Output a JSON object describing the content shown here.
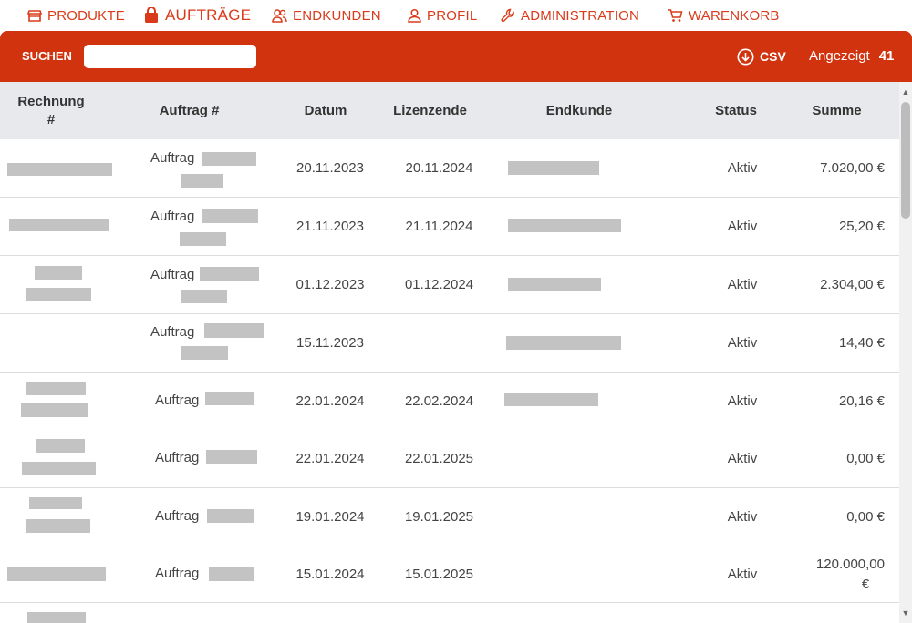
{
  "nav": [
    {
      "label": "PRODUKTE",
      "icon": "shop-icon"
    },
    {
      "label": "AUFTRÄGE",
      "icon": "bag-icon"
    },
    {
      "label": "ENDKUNDEN",
      "icon": "users-icon"
    },
    {
      "label": "PROFIL",
      "icon": "user-icon"
    },
    {
      "label": "ADMINISTRATION",
      "icon": "wrench-icon"
    },
    {
      "label": "WARENKORB",
      "icon": "cart-icon"
    }
  ],
  "toolbar": {
    "search_label": "SUCHEN",
    "search_value": "",
    "csv_label": "CSV",
    "shown_label": "Angezeigt",
    "shown_count": "41"
  },
  "table": {
    "headers": {
      "rechnung_line1": "Rechnung",
      "rechnung_line2": "#",
      "auftrag": "Auftrag #",
      "datum": "Datum",
      "lizenzende": "Lizenzende",
      "endkunde": "Endkunde",
      "status": "Status",
      "summe": "Summe"
    },
    "rows": [
      {
        "auftrag": "Auftrag",
        "datum": "20.11.2023",
        "lizenzende": "20.11.2024",
        "status": "Aktiv",
        "summe": "7.020,00 €"
      },
      {
        "auftrag": "Auftrag",
        "datum": "21.11.2023",
        "lizenzende": "21.11.2024",
        "status": "Aktiv",
        "summe": "25,20 €"
      },
      {
        "auftrag": "Auftrag",
        "datum": "01.12.2023",
        "lizenzende": "01.12.2024",
        "status": "Aktiv",
        "summe": "2.304,00 €"
      },
      {
        "auftrag": "Auftrag",
        "datum": "15.11.2023",
        "lizenzende": "",
        "status": "Aktiv",
        "summe": "14,40 €"
      },
      {
        "auftrag": "Auftrag",
        "datum": "22.01.2024",
        "lizenzende": "22.02.2024",
        "status": "Aktiv",
        "summe": "20,16 €"
      },
      {
        "auftrag": "Auftrag",
        "datum": "22.01.2024",
        "lizenzende": "22.01.2025",
        "status": "Aktiv",
        "summe": "0,00 €"
      },
      {
        "auftrag": "Auftrag",
        "datum": "19.01.2024",
        "lizenzende": "19.01.2025",
        "status": "Aktiv",
        "summe": "0,00 €"
      },
      {
        "auftrag": "Auftrag",
        "datum": "15.01.2024",
        "lizenzende": "15.01.2025",
        "status": "Aktiv",
        "summe_line1": "120.000,00",
        "summe_line2": "€"
      }
    ]
  },
  "colors": {
    "accent": "#d2330f",
    "header_bg": "#e8e9ec",
    "redaction": "#c3c3c3"
  }
}
